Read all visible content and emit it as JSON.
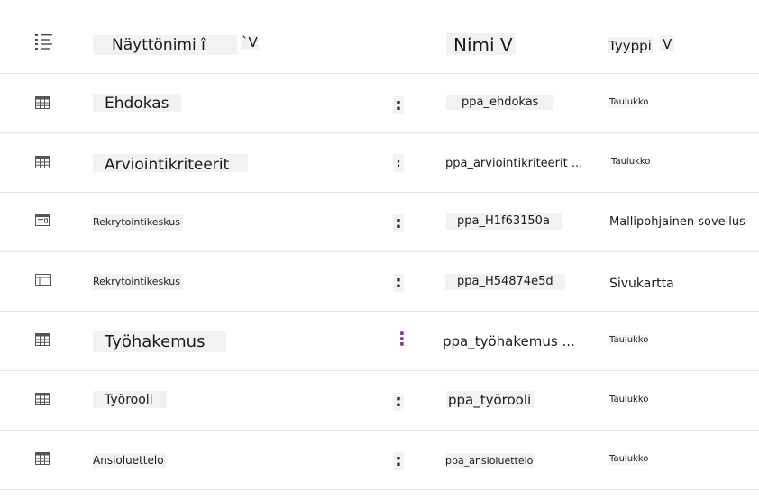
{
  "header": {
    "display_name_label": "Näyttönimi î",
    "display_name_sort": "`V",
    "name_label": "Nimi V",
    "type_label": "Tyyppi",
    "type_sort": "V"
  },
  "rows": [
    {
      "display_name": "Ehdokas",
      "more": ":",
      "name": "ppa_ehdokas",
      "type": "Taulukko",
      "icon": "table-icon"
    },
    {
      "display_name": "Arviointikriteerit",
      "more": ":",
      "name": "ppa_arviointikriteerit ...",
      "type": "Taulukko",
      "icon": "table-icon"
    },
    {
      "display_name": "Rekrytointikeskus",
      "more": ":",
      "name": "ppa_H1f63150a",
      "type": "Mallipohjainen sovellus",
      "icon": "model-driven-app-icon"
    },
    {
      "display_name": "Rekrytointikeskus",
      "more": ":",
      "name": "ppa_H54874e5d",
      "type": "Sivukartta",
      "icon": "sitemap-icon"
    },
    {
      "display_name": "Työhakemus",
      "more": "⋮",
      "name": "ppa_työhakemus ...",
      "type": "Taulukko",
      "icon": "table-icon"
    },
    {
      "display_name": "Työrooli",
      "more": ":",
      "name": "ppa_työrooli",
      "type": "Taulukko",
      "icon": "table-icon"
    },
    {
      "display_name": "Ansioluettelo",
      "more": ":",
      "name": "ppa_ansioluettelo",
      "type": "Taulukko",
      "icon": "table-icon"
    }
  ]
}
